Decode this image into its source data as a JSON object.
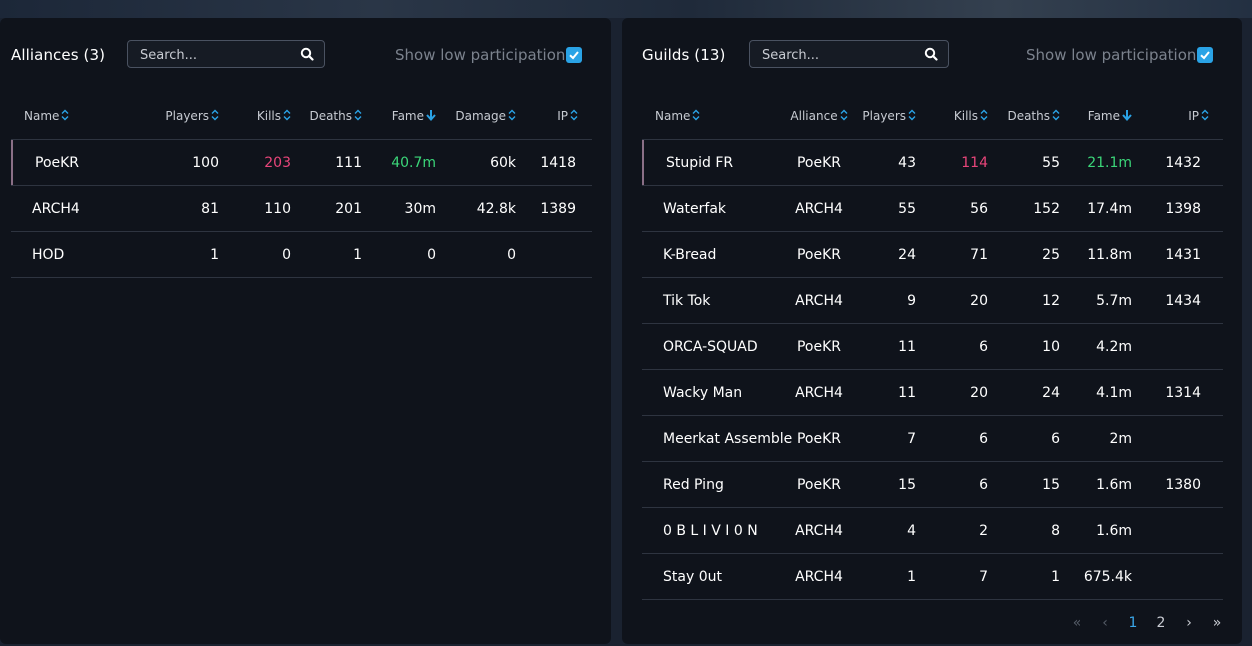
{
  "alliances": {
    "title": "Alliances (3)",
    "search_placeholder": "Search...",
    "toggle_label": "Show low participation",
    "columns": [
      "Name",
      "Players",
      "Kills",
      "Deaths",
      "Fame",
      "Damage",
      "IP"
    ],
    "rows": [
      {
        "name": "PoeKR",
        "players": "100",
        "kills": "203",
        "deaths": "111",
        "fame": "40.7m",
        "damage": "60k",
        "ip": "1418"
      },
      {
        "name": "ARCH4",
        "players": "81",
        "kills": "110",
        "deaths": "201",
        "fame": "30m",
        "damage": "42.8k",
        "ip": "1389"
      },
      {
        "name": "HOD",
        "players": "1",
        "kills": "0",
        "deaths": "1",
        "fame": "0",
        "damage": "0",
        "ip": ""
      }
    ]
  },
  "guilds": {
    "title": "Guilds (13)",
    "search_placeholder": "Search...",
    "toggle_label": "Show low participation",
    "columns": [
      "Name",
      "Alliance",
      "Players",
      "Kills",
      "Deaths",
      "Fame",
      "IP"
    ],
    "rows": [
      {
        "name": "Stupid FR",
        "alliance": "PoeKR",
        "players": "43",
        "kills": "114",
        "deaths": "55",
        "fame": "21.1m",
        "ip": "1432"
      },
      {
        "name": "Waterfak",
        "alliance": "ARCH4",
        "players": "55",
        "kills": "56",
        "deaths": "152",
        "fame": "17.4m",
        "ip": "1398"
      },
      {
        "name": "K-Bread",
        "alliance": "PoeKR",
        "players": "24",
        "kills": "71",
        "deaths": "25",
        "fame": "11.8m",
        "ip": "1431"
      },
      {
        "name": "Tik Tok",
        "alliance": "ARCH4",
        "players": "9",
        "kills": "20",
        "deaths": "12",
        "fame": "5.7m",
        "ip": "1434"
      },
      {
        "name": "ORCA-SQUAD",
        "alliance": "PoeKR",
        "players": "11",
        "kills": "6",
        "deaths": "10",
        "fame": "4.2m",
        "ip": ""
      },
      {
        "name": "Wacky Man",
        "alliance": "ARCH4",
        "players": "11",
        "kills": "20",
        "deaths": "24",
        "fame": "4.1m",
        "ip": "1314"
      },
      {
        "name": "Meerkat Assemble",
        "alliance": "PoeKR",
        "players": "7",
        "kills": "6",
        "deaths": "6",
        "fame": "2m",
        "ip": ""
      },
      {
        "name": "Red Ping",
        "alliance": "PoeKR",
        "players": "15",
        "kills": "6",
        "deaths": "15",
        "fame": "1.6m",
        "ip": "1380"
      },
      {
        "name": "0 B L I V I 0 N",
        "alliance": "ARCH4",
        "players": "4",
        "kills": "2",
        "deaths": "8",
        "fame": "1.6m",
        "ip": ""
      },
      {
        "name": "Stay 0ut",
        "alliance": "ARCH4",
        "players": "1",
        "kills": "7",
        "deaths": "1",
        "fame": "675.4k",
        "ip": ""
      }
    ],
    "pagination": {
      "first": "«",
      "prev": "‹",
      "pages": [
        "1",
        "2"
      ],
      "next": "›",
      "last": "»"
    }
  },
  "colors": {
    "accent": "#2aa3e6",
    "kills_highlight": "#e8457a",
    "fame_highlight": "#3bd679",
    "panel_bg": "#0f131b"
  }
}
